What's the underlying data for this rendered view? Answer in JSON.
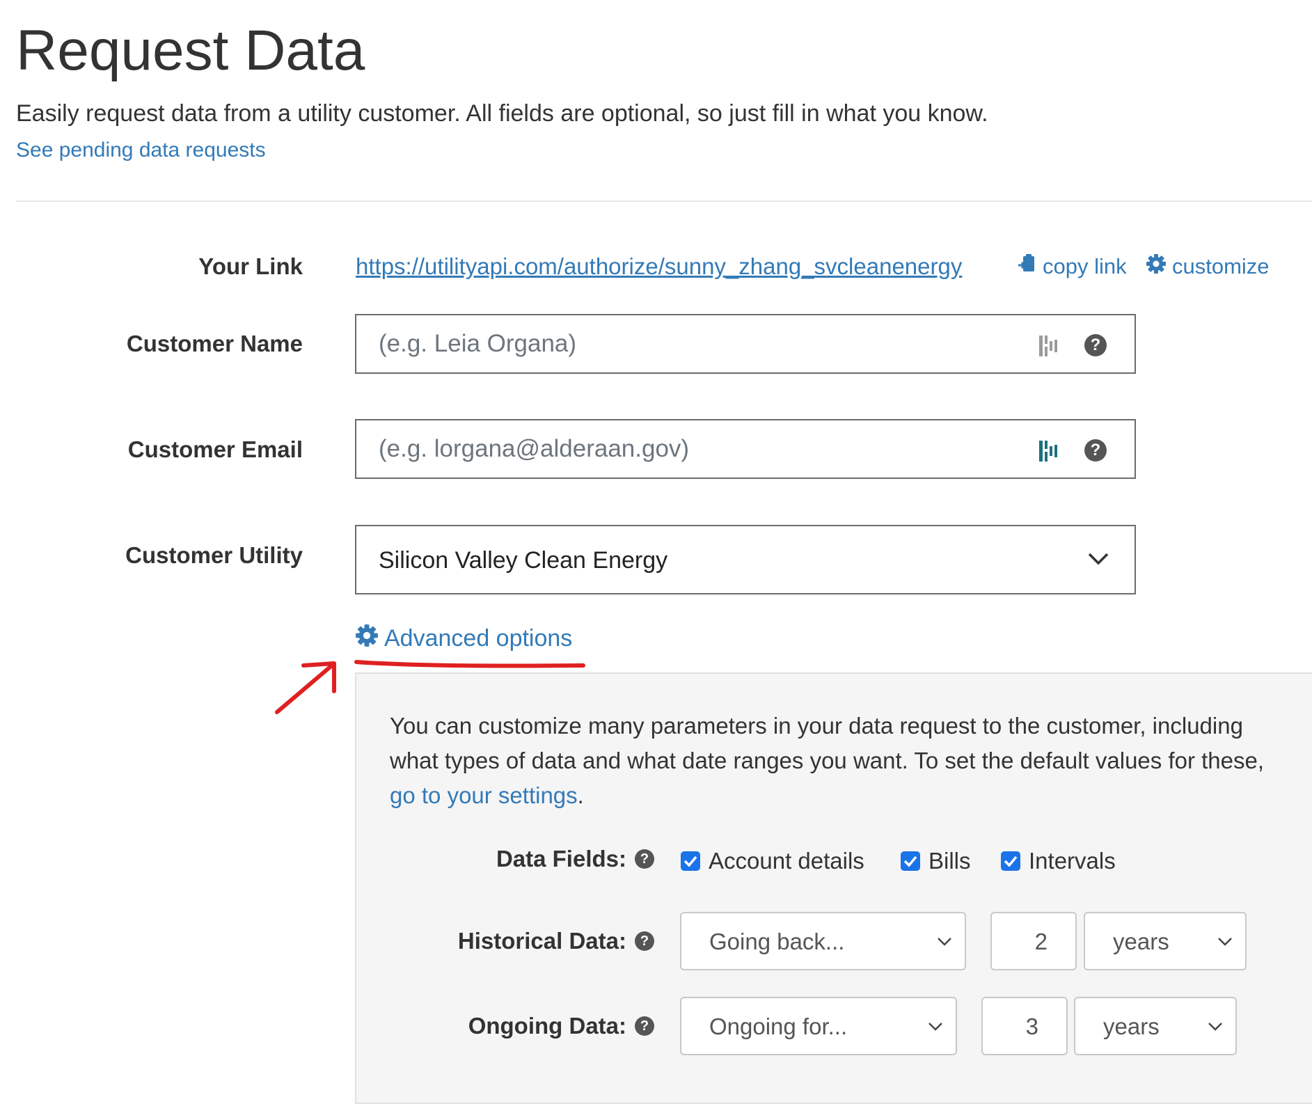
{
  "header": {
    "title": "Request Data",
    "description": "Easily request data from a utility customer. All fields are optional, so just fill in what you know.",
    "pending_link": "See pending data requests"
  },
  "form": {
    "your_link": {
      "label": "Your Link",
      "url": "https://utilityapi.com/authorize/sunny_zhang_svcleanenergy",
      "copy_label": "copy link",
      "customize_label": "customize"
    },
    "customer_name": {
      "label": "Customer Name",
      "placeholder": "(e.g. Leia Organa)",
      "help": "?"
    },
    "customer_email": {
      "label": "Customer Email",
      "placeholder": "(e.g. lorgana@alderaan.gov)",
      "help": "?"
    },
    "customer_utility": {
      "label": "Customer Utility",
      "value": "Silicon Valley Clean Energy"
    }
  },
  "advanced": {
    "toggle_label": "Advanced options",
    "intro_before": "You can customize many parameters in your data request to the customer, including what types of data and what date ranges you want. To set the default values for these, ",
    "intro_link": "go to your settings",
    "intro_after": ".",
    "data_fields": {
      "label": "Data Fields:",
      "options": [
        {
          "label": "Account details",
          "checked": true
        },
        {
          "label": "Bills",
          "checked": true
        },
        {
          "label": "Intervals",
          "checked": true
        }
      ]
    },
    "historical": {
      "label": "Historical Data:",
      "mode": "Going back...",
      "amount": "2",
      "unit": "years"
    },
    "ongoing": {
      "label": "Ongoing Data:",
      "mode": "Ongoing for...",
      "amount": "3",
      "unit": "years"
    }
  },
  "colors": {
    "link": "#337ab7",
    "checkbox": "#1a73e8",
    "annotation": "#e02020",
    "dash_icon_gray": "#9a9a9a",
    "dash_icon_teal": "#1e6f7c",
    "panel_bg": "#f5f5f5"
  }
}
